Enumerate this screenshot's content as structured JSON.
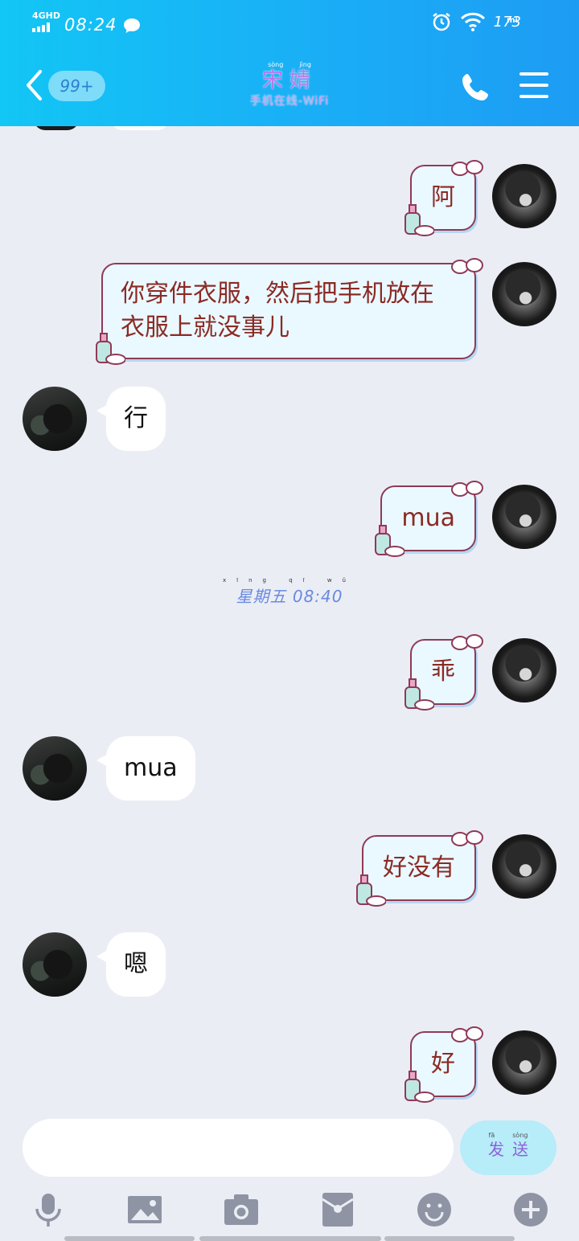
{
  "status_bar": {
    "network": "4GHD",
    "time": "08:24",
    "battery": "173",
    "mi": "mi"
  },
  "header": {
    "unread_badge": "99+",
    "title_pinyin": [
      "sòng",
      "jìng"
    ],
    "title": "宋婧",
    "subtitle": "手机在线-WiFi"
  },
  "messages": [
    {
      "side": "me",
      "text": "阿"
    },
    {
      "side": "me",
      "text": "你穿件衣服，然后把手机放在衣服上就没事儿"
    },
    {
      "side": "other",
      "text": "行"
    },
    {
      "side": "me",
      "text": "mua"
    },
    {
      "side": "timestamp",
      "text": "星期五 08:40",
      "pinyin": "xīng qī wǔ"
    },
    {
      "side": "me",
      "text": "乖"
    },
    {
      "side": "other",
      "text": "mua"
    },
    {
      "side": "me",
      "text": "好没有"
    },
    {
      "side": "other",
      "text": "嗯"
    },
    {
      "side": "me",
      "text": "好"
    }
  ],
  "input": {
    "placeholder": "",
    "send_label": "发送",
    "send_pinyin": [
      "fā",
      "sòng"
    ]
  },
  "toolbar": [
    "microphone-icon",
    "image-icon",
    "camera-icon",
    "red-packet-icon",
    "emoji-icon",
    "plus-icon"
  ],
  "colors": {
    "header_start": "#12c6f5",
    "header_end": "#1d9cf4",
    "background": "#ebedf5",
    "my_bubble_bg": "#eaf9ff",
    "my_bubble_border": "#8f3a58",
    "my_text": "#8b2a25",
    "send_button": "#b7ecf9"
  }
}
